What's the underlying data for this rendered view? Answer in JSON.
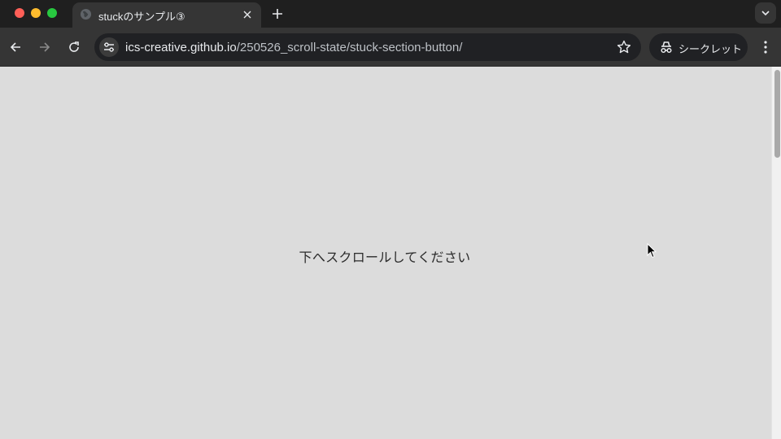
{
  "browser": {
    "tab": {
      "title": "stuckのサンプル③",
      "favicon": "globe-icon",
      "close": "close-icon"
    },
    "new_tab": "plus-icon",
    "tab_search": "chevron-down-icon",
    "toolbar": {
      "back": "arrow-left-icon",
      "forward": "arrow-right-icon",
      "reload": "reload-icon",
      "url_host": "ics-creative.github.io",
      "url_path": "/250526_scroll-state/stuck-section-button/",
      "bookmark": "star-icon",
      "incognito_label": "シークレット",
      "menu": "kebab-menu-icon"
    }
  },
  "page": {
    "message": "下へスクロールしてください",
    "background": "#dcdcdc"
  },
  "colors": {
    "close_red": "#ff5f57",
    "minimize_yellow": "#febc2e",
    "zoom_green": "#28c840"
  }
}
